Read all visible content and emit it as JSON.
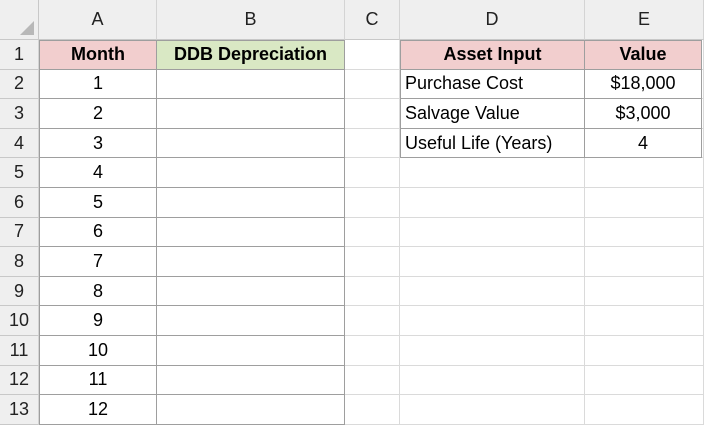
{
  "columns": [
    "A",
    "B",
    "C",
    "D",
    "E"
  ],
  "rows": [
    "1",
    "2",
    "3",
    "4",
    "5",
    "6",
    "7",
    "8",
    "9",
    "10",
    "11",
    "12",
    "13"
  ],
  "header": {
    "month": "Month",
    "ddb": "DDB Depreciation",
    "asset_input": "Asset Input",
    "value": "Value"
  },
  "months": [
    "1",
    "2",
    "3",
    "4",
    "5",
    "6",
    "7",
    "8",
    "9",
    "10",
    "11",
    "12"
  ],
  "assets": [
    {
      "label": "Purchase Cost",
      "value": "$18,000"
    },
    {
      "label": "Salvage Value",
      "value": "$3,000"
    },
    {
      "label": "Useful Life (Years)",
      "value": "4"
    }
  ],
  "colors": {
    "month_header_fill": "#f2cece",
    "ddb_header_fill": "#d9e8c4",
    "asset_header_fill": "#f2cece"
  }
}
